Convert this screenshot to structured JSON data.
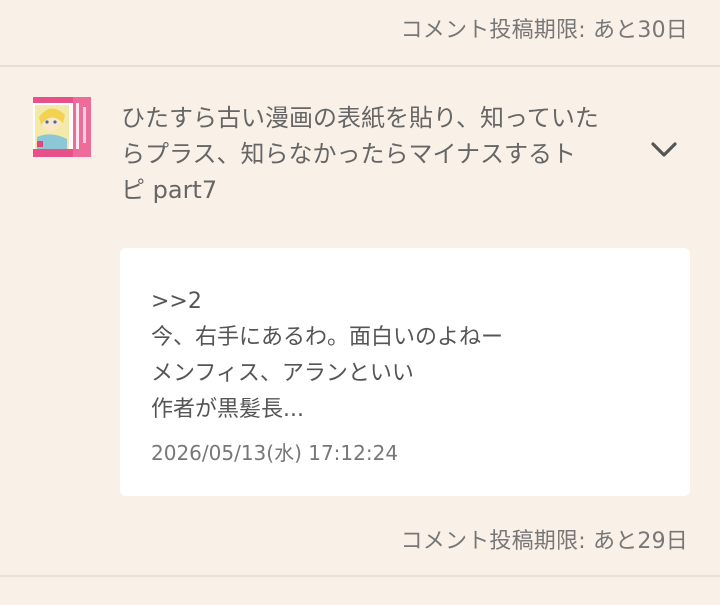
{
  "header": {
    "deadline": "コメント投稿期限: あと30日"
  },
  "topic": {
    "thumbnail_icon": "manga-cover-thumbnail",
    "title": "ひたすら古い漫画の表紙を貼り、知っていたらプラス、知らなかったらマイナスするトピ part7",
    "expand_icon": "chevron-down-icon"
  },
  "comment": {
    "lines": [
      ">>2",
      "今、右手にあるわ。面白いのよねー",
      "メンフィス、アランといい",
      "作者が黒髪長..."
    ],
    "datetime": "2026/05/13(水) 17:12:24"
  },
  "footer": {
    "deadline": "コメント投稿期限: あと29日"
  },
  "colors": {
    "background": "#f9f1e7",
    "card": "#ffffff",
    "text": "#666666",
    "divider": "#eadfd2"
  }
}
